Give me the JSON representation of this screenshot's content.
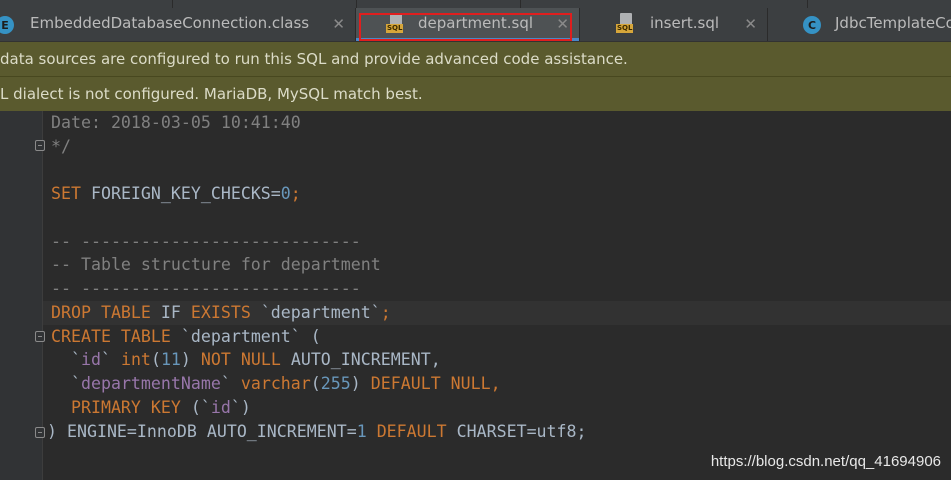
{
  "tabs": [
    {
      "label": "EmbeddedDatabaseConnection.class",
      "icon": "class-icon",
      "active": false
    },
    {
      "label": "department.sql",
      "icon": "sql-file-icon",
      "active": true
    },
    {
      "label": "insert.sql",
      "icon": "sql-file-icon",
      "active": false
    },
    {
      "label": "JdbcTemplateCo",
      "icon": "class-icon",
      "active": false
    }
  ],
  "icon_text": {
    "class_e": "E",
    "class_c": "C",
    "sql": "SQL"
  },
  "banners": {
    "data_sources": "data sources are configured to run this SQL and provide advanced code assistance.",
    "dialect": "L dialect is not configured. MariaDB, MySQL match best."
  },
  "code": {
    "l1": "Date: 2018-03-05 10:41:40",
    "l2": "*/",
    "l3_kw": "SET",
    "l3_rest": " FOREIGN_KEY_CHECKS=",
    "l3_num": "0",
    "l3_end": ";",
    "l4": "-- ----------------------------",
    "l5": "-- Table structure for department",
    "l6": "-- ----------------------------",
    "l7_a": "DROP TABLE",
    "l7_b": " IF ",
    "l7_c": "EXISTS",
    "l7_d": " `department`",
    "l7_e": ";",
    "l8_a": "CREATE TABLE",
    "l8_b": " `department` (",
    "l9_a": "  `",
    "l9_b": "id",
    "l9_c": "` ",
    "l9_d": "int",
    "l9_e": "(",
    "l9_f": "11",
    "l9_g": ") ",
    "l9_h": "NOT NULL",
    "l9_i": " AUTO_INCREMENT,",
    "l10_a": "  `",
    "l10_b": "departmentName",
    "l10_c": "` ",
    "l10_d": "varchar",
    "l10_e": "(",
    "l10_f": "255",
    "l10_g": ") ",
    "l10_h": "DEFAULT NULL",
    "l10_i": ",",
    "l11_a": "  PRIMARY KEY",
    "l11_b": " (`",
    "l11_c": "id",
    "l11_d": "`)",
    "l12_a": ") ENGINE=InnoDB AUTO_INCREMENT=",
    "l12_b": "1",
    "l12_c": " DEFAULT",
    "l12_d": " CHARSET=utf8;"
  },
  "watermark": "https://blog.csdn.net/qq_41694906",
  "colors": {
    "accent": "#4a88c7",
    "highlight": "#e01e1e",
    "banner": "#5a5a2e",
    "keyword": "#cc7832",
    "comment": "#808080"
  }
}
